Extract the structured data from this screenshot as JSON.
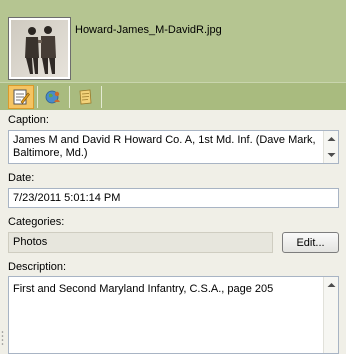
{
  "header": {
    "filename": "Howard-James_M-DavidR.jpg"
  },
  "toolbar": {
    "buttons": [
      {
        "icon": "edit-properties-icon",
        "active": true
      },
      {
        "icon": "people-map-icon",
        "active": false
      },
      {
        "icon": "notes-icon",
        "active": false
      }
    ]
  },
  "caption": {
    "label": "Caption:",
    "value": "James M and David R Howard Co. A, 1st Md. Inf. (Dave Mark, Baltimore, Md.)"
  },
  "date": {
    "label": "Date:",
    "value": "7/23/2011 5:01:14 PM"
  },
  "categories": {
    "label": "Categories:",
    "value": "Photos",
    "edit_button": "Edit..."
  },
  "description": {
    "label": "Description:",
    "value": "First and Second Maryland Infantry, C.S.A., page 205"
  },
  "colors": {
    "header_bg": "#b5c591",
    "toolbar_bg": "#a9bb7f",
    "active_button": "#f5c462",
    "panel_bg": "#f0efe7"
  }
}
